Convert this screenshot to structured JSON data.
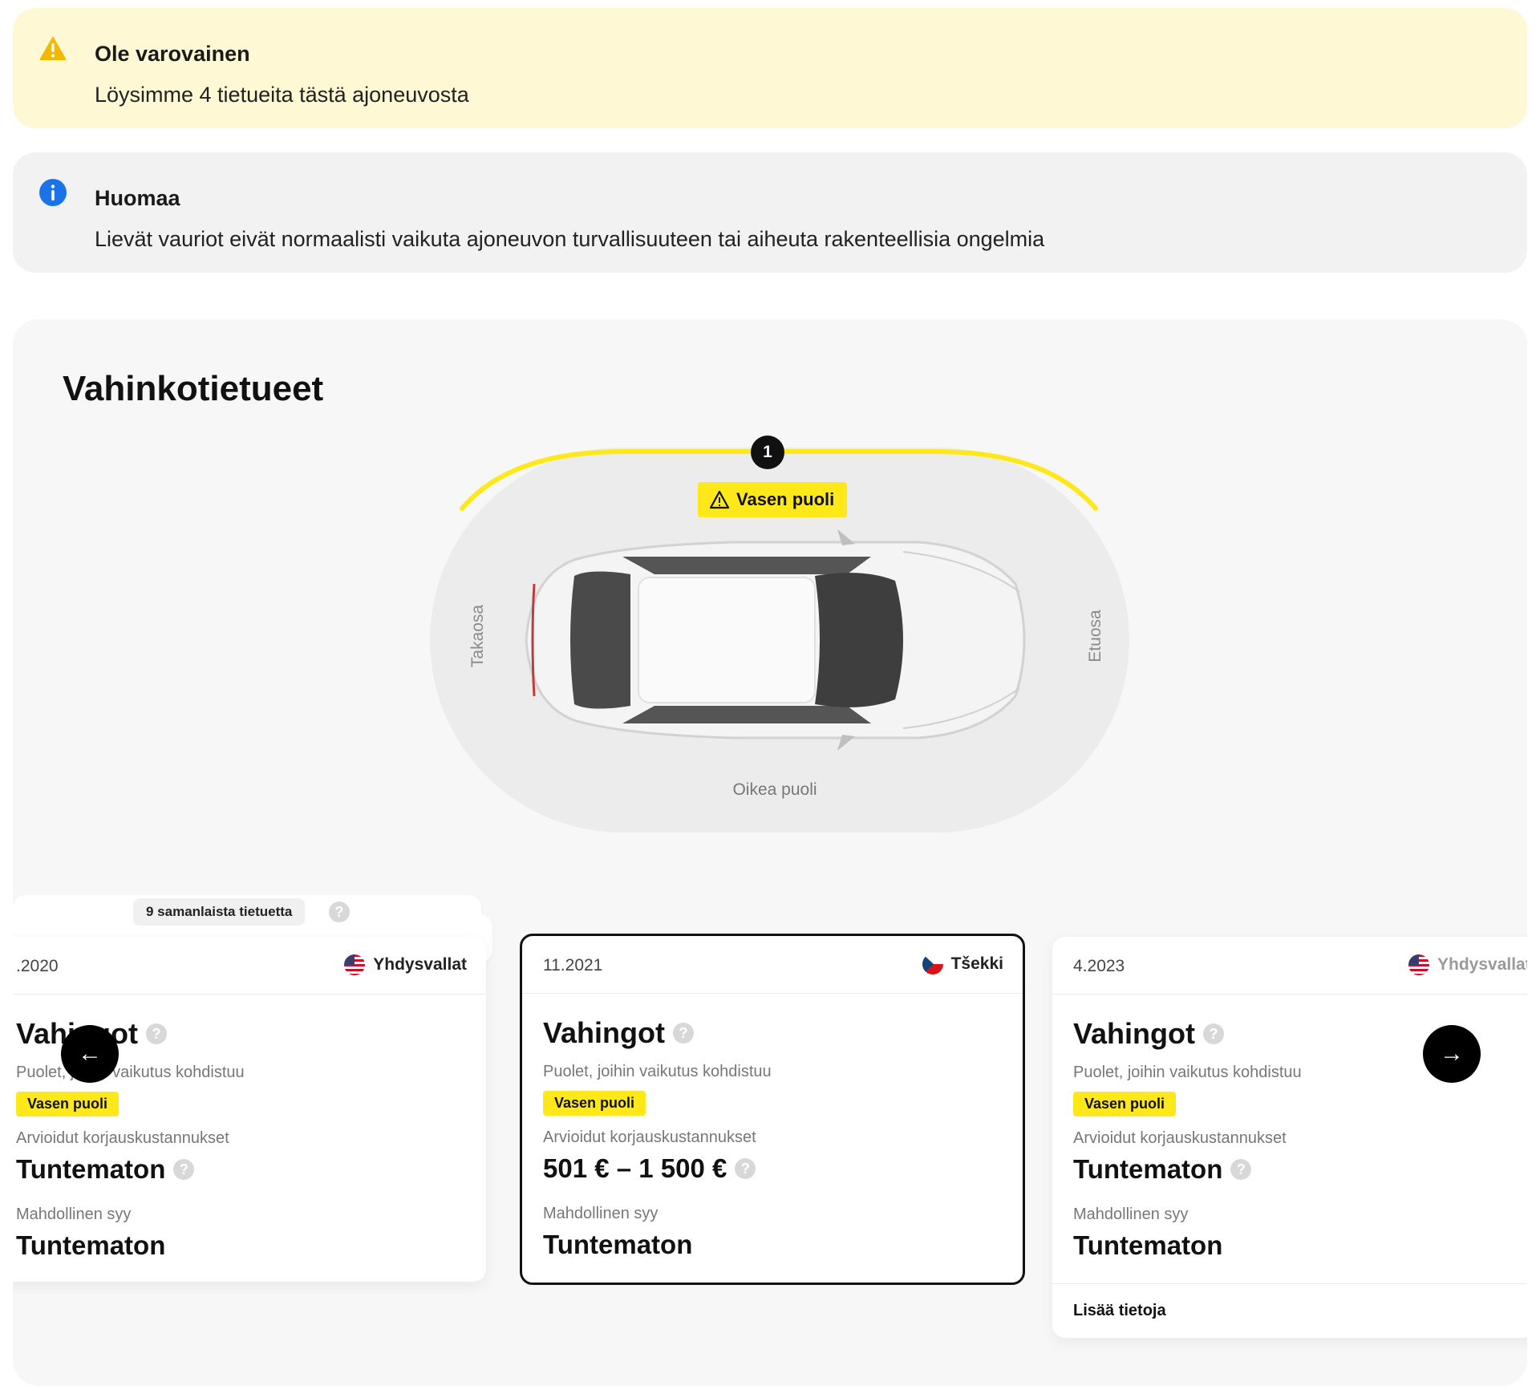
{
  "warning": {
    "icon": "warning-triangle-icon",
    "title": "Ole varovainen",
    "text": "Löysimme 4 tietueita tästä ajoneuvosta",
    "color": "#f5b800"
  },
  "info": {
    "icon": "info-circle-icon",
    "title": "Huomaa",
    "text": "Lievät vauriot eivät normaalisti vaikuta ajoneuvon turvallisuuteen tai aiheuta rakenteellisia ongelmia",
    "color": "#1a73e8"
  },
  "records": {
    "title": "Vahinkotietueet",
    "diagram": {
      "marker_count": "1",
      "side_tag": "Vasen puoli",
      "label_rear": "Takaosa",
      "label_front": "Etuosa",
      "label_right": "Oikea puoli",
      "highlight_color": "#ffe81a"
    },
    "stack_label": "9 samanlaista tietuetta",
    "cards": [
      {
        "date": ".2020",
        "country": "Yhdysvallat",
        "flag": "us-flag-icon",
        "heading": "Vahingot",
        "affected_label": "Puolet, joihin vaikutus kohdistuu",
        "affected_chip": "Vasen puoli",
        "cost_label": "Arvioidut korjauskustannukset",
        "cost_value": "Tuntematon",
        "cause_label": "Mahdollinen syy",
        "cause_value": "Tuntematon"
      },
      {
        "date": "11.2021",
        "country": "Tšekki",
        "flag": "czech-flag-icon",
        "heading": "Vahingot",
        "affected_label": "Puolet, joihin vaikutus kohdistuu",
        "affected_chip": "Vasen puoli",
        "cost_label": "Arvioidut korjauskustannukset",
        "cost_value": "501 € – 1 500 €",
        "cause_label": "Mahdollinen syy",
        "cause_value": "Tuntematon"
      },
      {
        "date": "4.2023",
        "country": "Yhdysvallat",
        "flag": "us-flag-icon",
        "heading": "Vahingot",
        "affected_label": "Puolet, joihin vaikutus kohdistuu",
        "affected_chip": "Vasen puoli",
        "cost_label": "Arvioidut korjauskustannukset",
        "cost_value": "Tuntematon",
        "cause_label": "Mahdollinen syy",
        "cause_value": "Tuntematon",
        "more_link": "Lisää tietoja"
      }
    ],
    "nav_prev": "←",
    "nav_next": "→"
  }
}
